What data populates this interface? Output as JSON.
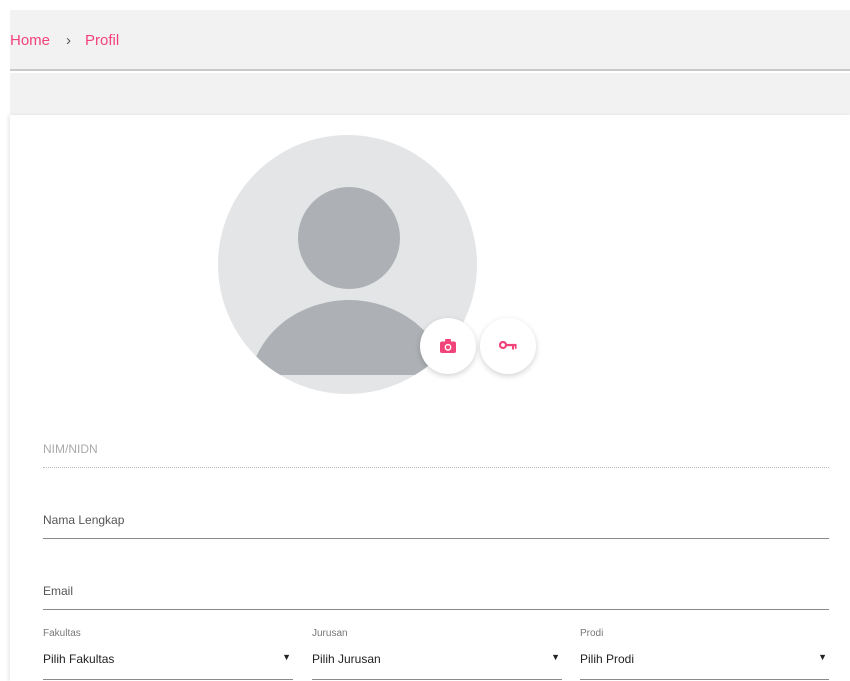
{
  "breadcrumb": {
    "home": "Home",
    "separator": "›",
    "current": "Profil"
  },
  "profile": {
    "avatar_alt": "default user avatar"
  },
  "actions": {
    "camera_icon": "camera-icon",
    "key_icon": "key-icon"
  },
  "form": {
    "nim_placeholder": "NIM/NIDN",
    "nama_placeholder": "Nama Lengkap",
    "email_placeholder": "Email",
    "fakultas": {
      "label": "Fakultas",
      "value": "Pilih Fakultas",
      "arrow": "▼"
    },
    "jurusan": {
      "label": "Jurusan",
      "value": "Pilih Jurusan",
      "arrow": "▼"
    },
    "prodi": {
      "label": "Prodi",
      "value": "Pilih Prodi",
      "arrow": "▼"
    }
  },
  "colors": {
    "accent": "#f2437a",
    "topbar_bg": "#f2f2f3",
    "avatar_bg": "#e4e5e7",
    "avatar_fg": "#adb1b5"
  }
}
